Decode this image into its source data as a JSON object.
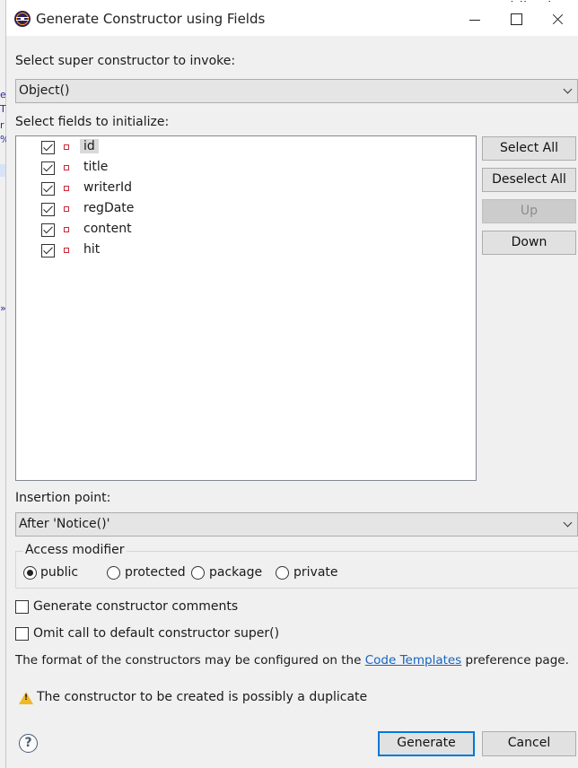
{
  "window": {
    "title": "Generate Constructor using Fields"
  },
  "super_constructor": {
    "label": "Select super constructor to invoke:",
    "value": "Object()"
  },
  "fields": {
    "label": "Select fields to initialize:",
    "items": [
      {
        "name": "id",
        "checked": true,
        "selected": true
      },
      {
        "name": "title",
        "checked": true
      },
      {
        "name": "writerId",
        "checked": true
      },
      {
        "name": "regDate",
        "checked": true
      },
      {
        "name": "content",
        "checked": true
      },
      {
        "name": "hit",
        "checked": true
      }
    ]
  },
  "side_buttons": {
    "select_all": "Select All",
    "deselect_all": "Deselect All",
    "up": "Up",
    "down": "Down"
  },
  "insertion": {
    "label": "Insertion point:",
    "value": "After 'Notice()'"
  },
  "access": {
    "legend": "Access modifier",
    "options": [
      "public",
      "protected",
      "package",
      "private"
    ],
    "selected": "public"
  },
  "options": {
    "generate_comments": {
      "label": "Generate constructor comments",
      "checked": false
    },
    "omit_super": {
      "label": "Omit call to default constructor super()",
      "checked": false
    }
  },
  "info": {
    "prefix": "The format of the constructors may be configured on the",
    "link": "Code Templates",
    "suffix": "preference page."
  },
  "warning": "The constructor to be created is possibly a duplicate",
  "footer": {
    "generate": "Generate",
    "cancel": "Cancel"
  }
}
